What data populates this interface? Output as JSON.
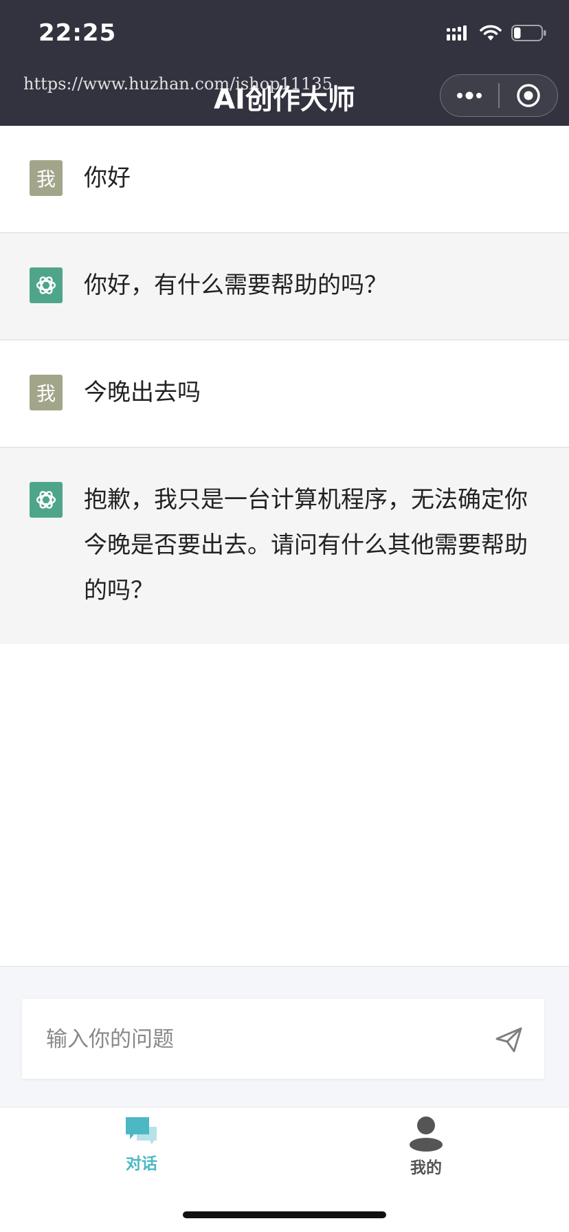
{
  "status_bar": {
    "time": "22:25",
    "battery_level": 0.25
  },
  "watermark": "https://www.huzhan.com/ishop11135",
  "header": {
    "title": "AI创作大师"
  },
  "messages": [
    {
      "role": "user",
      "avatar": "我",
      "text": "你好"
    },
    {
      "role": "bot",
      "avatar": "openai-logo-icon",
      "text": "你好，有什么需要帮助的吗？"
    },
    {
      "role": "user",
      "avatar": "我",
      "text": "今晚出去吗"
    },
    {
      "role": "bot",
      "avatar": "openai-logo-icon",
      "text": "抱歉，我只是一台计算机程序，无法确定你今晚是否要出去。请问有什么其他需要帮助的吗？"
    }
  ],
  "input": {
    "placeholder": "输入你的问题",
    "value": ""
  },
  "tabs": [
    {
      "label": "对话",
      "icon": "chat-bubbles-icon",
      "active": true,
      "color": "#4bb8c4"
    },
    {
      "label": "我的",
      "icon": "user-profile-icon",
      "active": false,
      "color": "#555555"
    }
  ],
  "colors": {
    "header_bg": "#33333f",
    "user_avatar": "#a2a58a",
    "bot_avatar": "#4ea58a",
    "bot_row_bg": "#f5f5f5",
    "accent": "#4bb8c4"
  }
}
